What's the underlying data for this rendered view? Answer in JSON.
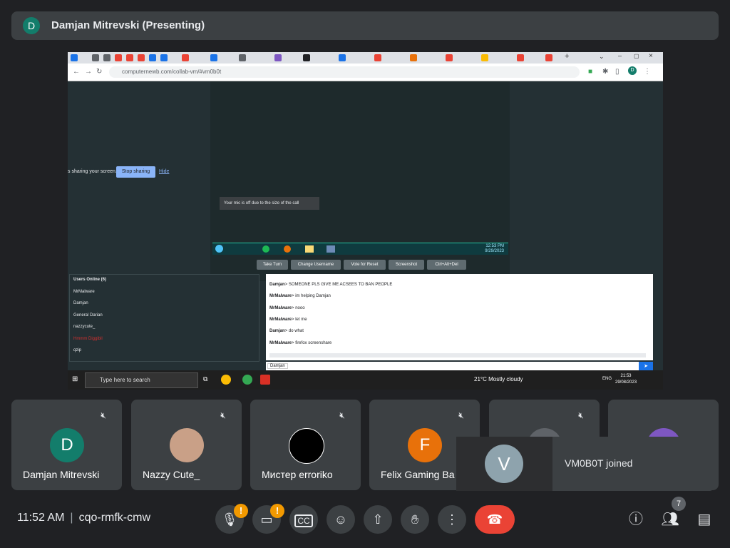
{
  "presenting_bar": {
    "initial": "D",
    "title": "Damjan Mitrevski (Presenting)",
    "avatar_color": "#137d6b"
  },
  "browser": {
    "url": "computernewb.com/collab-vm/#vm0b0t"
  },
  "vm_page": {
    "sharing_text": "s sharing your screen.",
    "stop_sharing": "Stop sharing",
    "hide": "Hide",
    "mic_note": "Your mic is off due to the size of the call",
    "vm_clock_time": "12:53 PM",
    "vm_clock_date": "9/29/2023",
    "buttons": [
      "Take Turn",
      "Change Username",
      "Vote for Reset",
      "Screenshot",
      "Ctrl+Alt+Del"
    ],
    "users_header": "Users Online (6)",
    "users": [
      "MrMalware",
      "Damjan",
      "General Darian",
      "nazzycute_",
      "Hmmm Diggibil",
      "qzip"
    ],
    "chat": [
      {
        "from": "Damjan",
        "text": "SOMEONE PLS GIVE ME ACSEES TO BAN PEOPLE"
      },
      {
        "from": "MrMalware",
        "text": "im helping Damjan"
      },
      {
        "from": "MrMalware",
        "text": "nooo"
      },
      {
        "from": "MrMalware",
        "text": "let me"
      },
      {
        "from": "Damjan",
        "text": "do what"
      },
      {
        "from": "MrMalware",
        "text": "firefox screenshare"
      }
    ],
    "chat_user": "Damjan",
    "send_icon": "send-icon"
  },
  "host_taskbar": {
    "search_placeholder": "Type here to search",
    "weather": "21°C  Mostly cloudy",
    "lang": "ENG",
    "time": "21:53",
    "date": "29/08/2023"
  },
  "participants": [
    {
      "name": "Damjan Mitrevski",
      "initial": "D",
      "color": "#137d6b"
    },
    {
      "name": "Nazzy Cute_",
      "initial": "",
      "color": "#c9a087"
    },
    {
      "name": "Мистер erroriko",
      "initial": "",
      "color": "#000000"
    },
    {
      "name": "Felix Gaming Ba",
      "initial": "F",
      "color": "#e8710a"
    },
    {
      "name": "",
      "initial": "",
      "color": "#5f6368"
    },
    {
      "name": "",
      "initial": "",
      "color": "#7e57c2"
    }
  ],
  "toast": {
    "initial": "V",
    "message": "VM0B0T joined"
  },
  "bottom_bar": {
    "time": "11:52 AM",
    "meeting_code": "cqo-rmfk-cmw",
    "people_count": "7",
    "mic_badge": "!",
    "cam_badge": "!"
  }
}
